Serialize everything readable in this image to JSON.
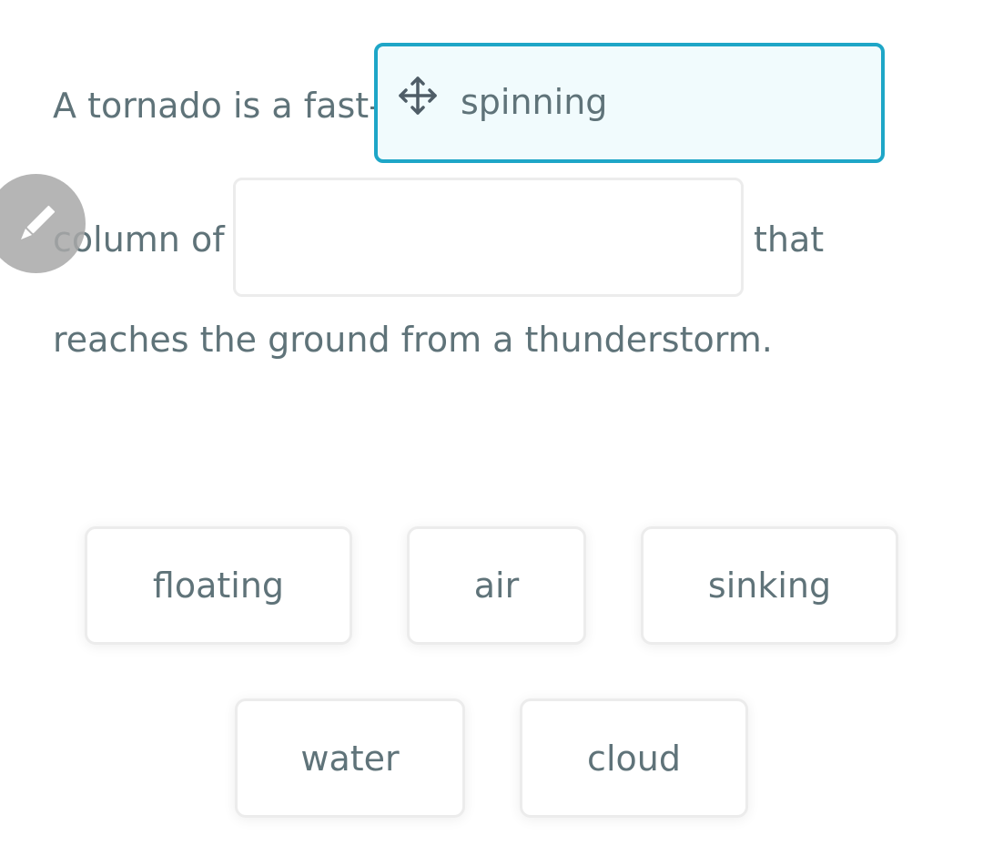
{
  "sentence": {
    "line1_prefix": "A tornado is a fast-",
    "line2_prefix": "column of",
    "line2_suffix": "that",
    "line3": "reaches the ground from a thunderstorm."
  },
  "blanks": {
    "filled_word": "spinning",
    "empty_word": ""
  },
  "word_bank": {
    "floating": "floating",
    "air": "air",
    "sinking": "sinking",
    "water": "water",
    "cloud": "cloud"
  },
  "icons": {
    "drag": "move-arrows-icon",
    "edit": "pencil-icon"
  },
  "colors": {
    "accent": "#1ea6c7",
    "text": "#5f7379"
  }
}
